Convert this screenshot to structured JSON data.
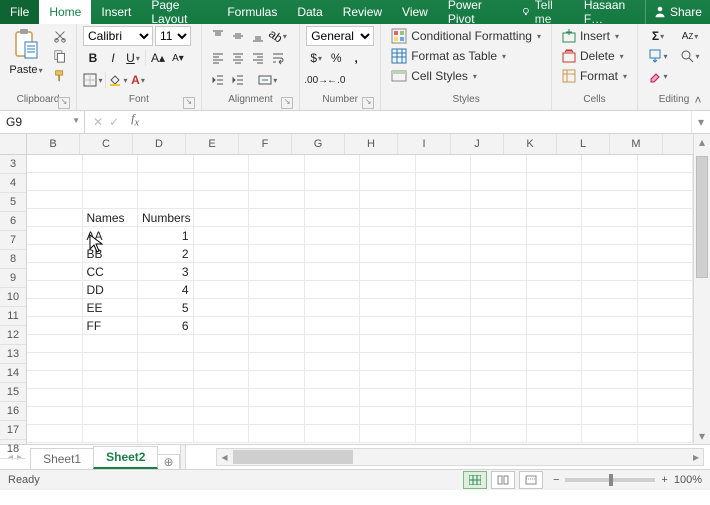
{
  "tabs": {
    "file": "File",
    "home": "Home",
    "insert": "Insert",
    "page_layout": "Page Layout",
    "formulas": "Formulas",
    "data": "Data",
    "review": "Review",
    "view": "View",
    "power_pivot": "Power Pivot"
  },
  "tellme": "Tell me",
  "user": "Hasaan F…",
  "share": "Share",
  "clipboard": {
    "paste": "Paste",
    "label": "Clipboard"
  },
  "font": {
    "name": "Calibri",
    "size": "11",
    "label": "Font"
  },
  "alignment": {
    "label": "Alignment"
  },
  "number": {
    "format": "General",
    "label": "Number"
  },
  "styles": {
    "cond": "Conditional Formatting",
    "table": "Format as Table",
    "cell": "Cell Styles",
    "label": "Styles"
  },
  "cells": {
    "insert": "Insert",
    "delete": "Delete",
    "format": "Format",
    "label": "Cells"
  },
  "editing": {
    "label": "Editing"
  },
  "namebox": "G9",
  "formula": "",
  "columns": [
    "B",
    "C",
    "D",
    "E",
    "F",
    "G",
    "H",
    "I",
    "J",
    "K",
    "L",
    "M"
  ],
  "first_row": 3,
  "row_count": 16,
  "data_rows": [
    {
      "r": 6,
      "C": "Names",
      "D": "Numbers"
    },
    {
      "r": 7,
      "C": "AA",
      "D": "1"
    },
    {
      "r": 8,
      "C": "BB",
      "D": "2"
    },
    {
      "r": 9,
      "C": "CC",
      "D": "3"
    },
    {
      "r": 10,
      "C": "DD",
      "D": "4"
    },
    {
      "r": 11,
      "C": "EE",
      "D": "5"
    },
    {
      "r": 12,
      "C": "FF",
      "D": "6"
    }
  ],
  "sheets": {
    "s1": "Sheet1",
    "s2": "Sheet2"
  },
  "status": {
    "ready": "Ready",
    "zoom": "100%",
    "minus": "−",
    "plus": "+"
  }
}
